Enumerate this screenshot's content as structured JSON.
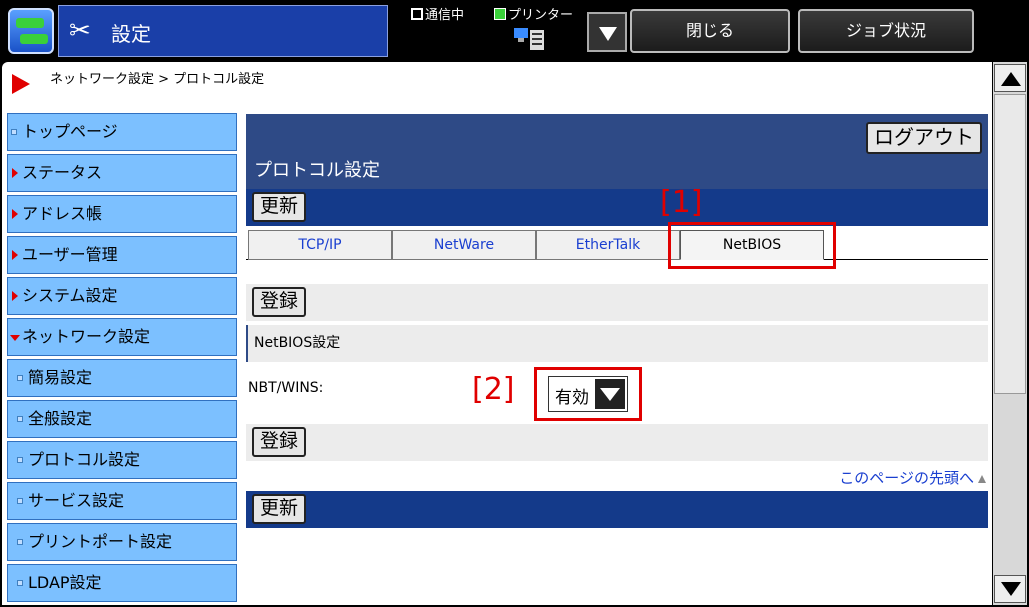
{
  "app": {
    "title": "設定",
    "status_comm": "通信中",
    "status_printer": "プリンター",
    "close_label": "閉じる",
    "job_status_label": "ジョブ状況"
  },
  "breadcrumb": "ネットワーク設定 > プロトコル設定",
  "sidebar": {
    "items": [
      {
        "label": "トップページ"
      },
      {
        "label": "ステータス"
      },
      {
        "label": "アドレス帳"
      },
      {
        "label": "ユーザー管理"
      },
      {
        "label": "システム設定"
      },
      {
        "label": "ネットワーク設定"
      },
      {
        "label": "簡易設定"
      },
      {
        "label": "全般設定"
      },
      {
        "label": "プロトコル設定"
      },
      {
        "label": "サービス設定"
      },
      {
        "label": "プリントポート設定"
      },
      {
        "label": "LDAP設定"
      }
    ]
  },
  "main": {
    "logout_label": "ログアウト",
    "page_title": "プロトコル設定",
    "update_label": "更新",
    "register_label": "登録",
    "annotation1": "[1]",
    "annotation2": "[2]",
    "tabs": [
      {
        "label": "TCP/IP"
      },
      {
        "label": "NetWare"
      },
      {
        "label": "EtherTalk"
      },
      {
        "label": "NetBIOS"
      }
    ],
    "active_tab": "NetBIOS",
    "section_title": "NetBIOS設定",
    "nbt_label": "NBT/WINS:",
    "nbt_value": "有効",
    "top_link": "このページの先頭へ"
  },
  "colors": {
    "header_blue": "#2e4a86",
    "bar_blue": "#143a8a",
    "sidebar_blue": "#7cc0ff",
    "annotation_red": "#e00000",
    "link_blue": "#1a3fd0"
  }
}
